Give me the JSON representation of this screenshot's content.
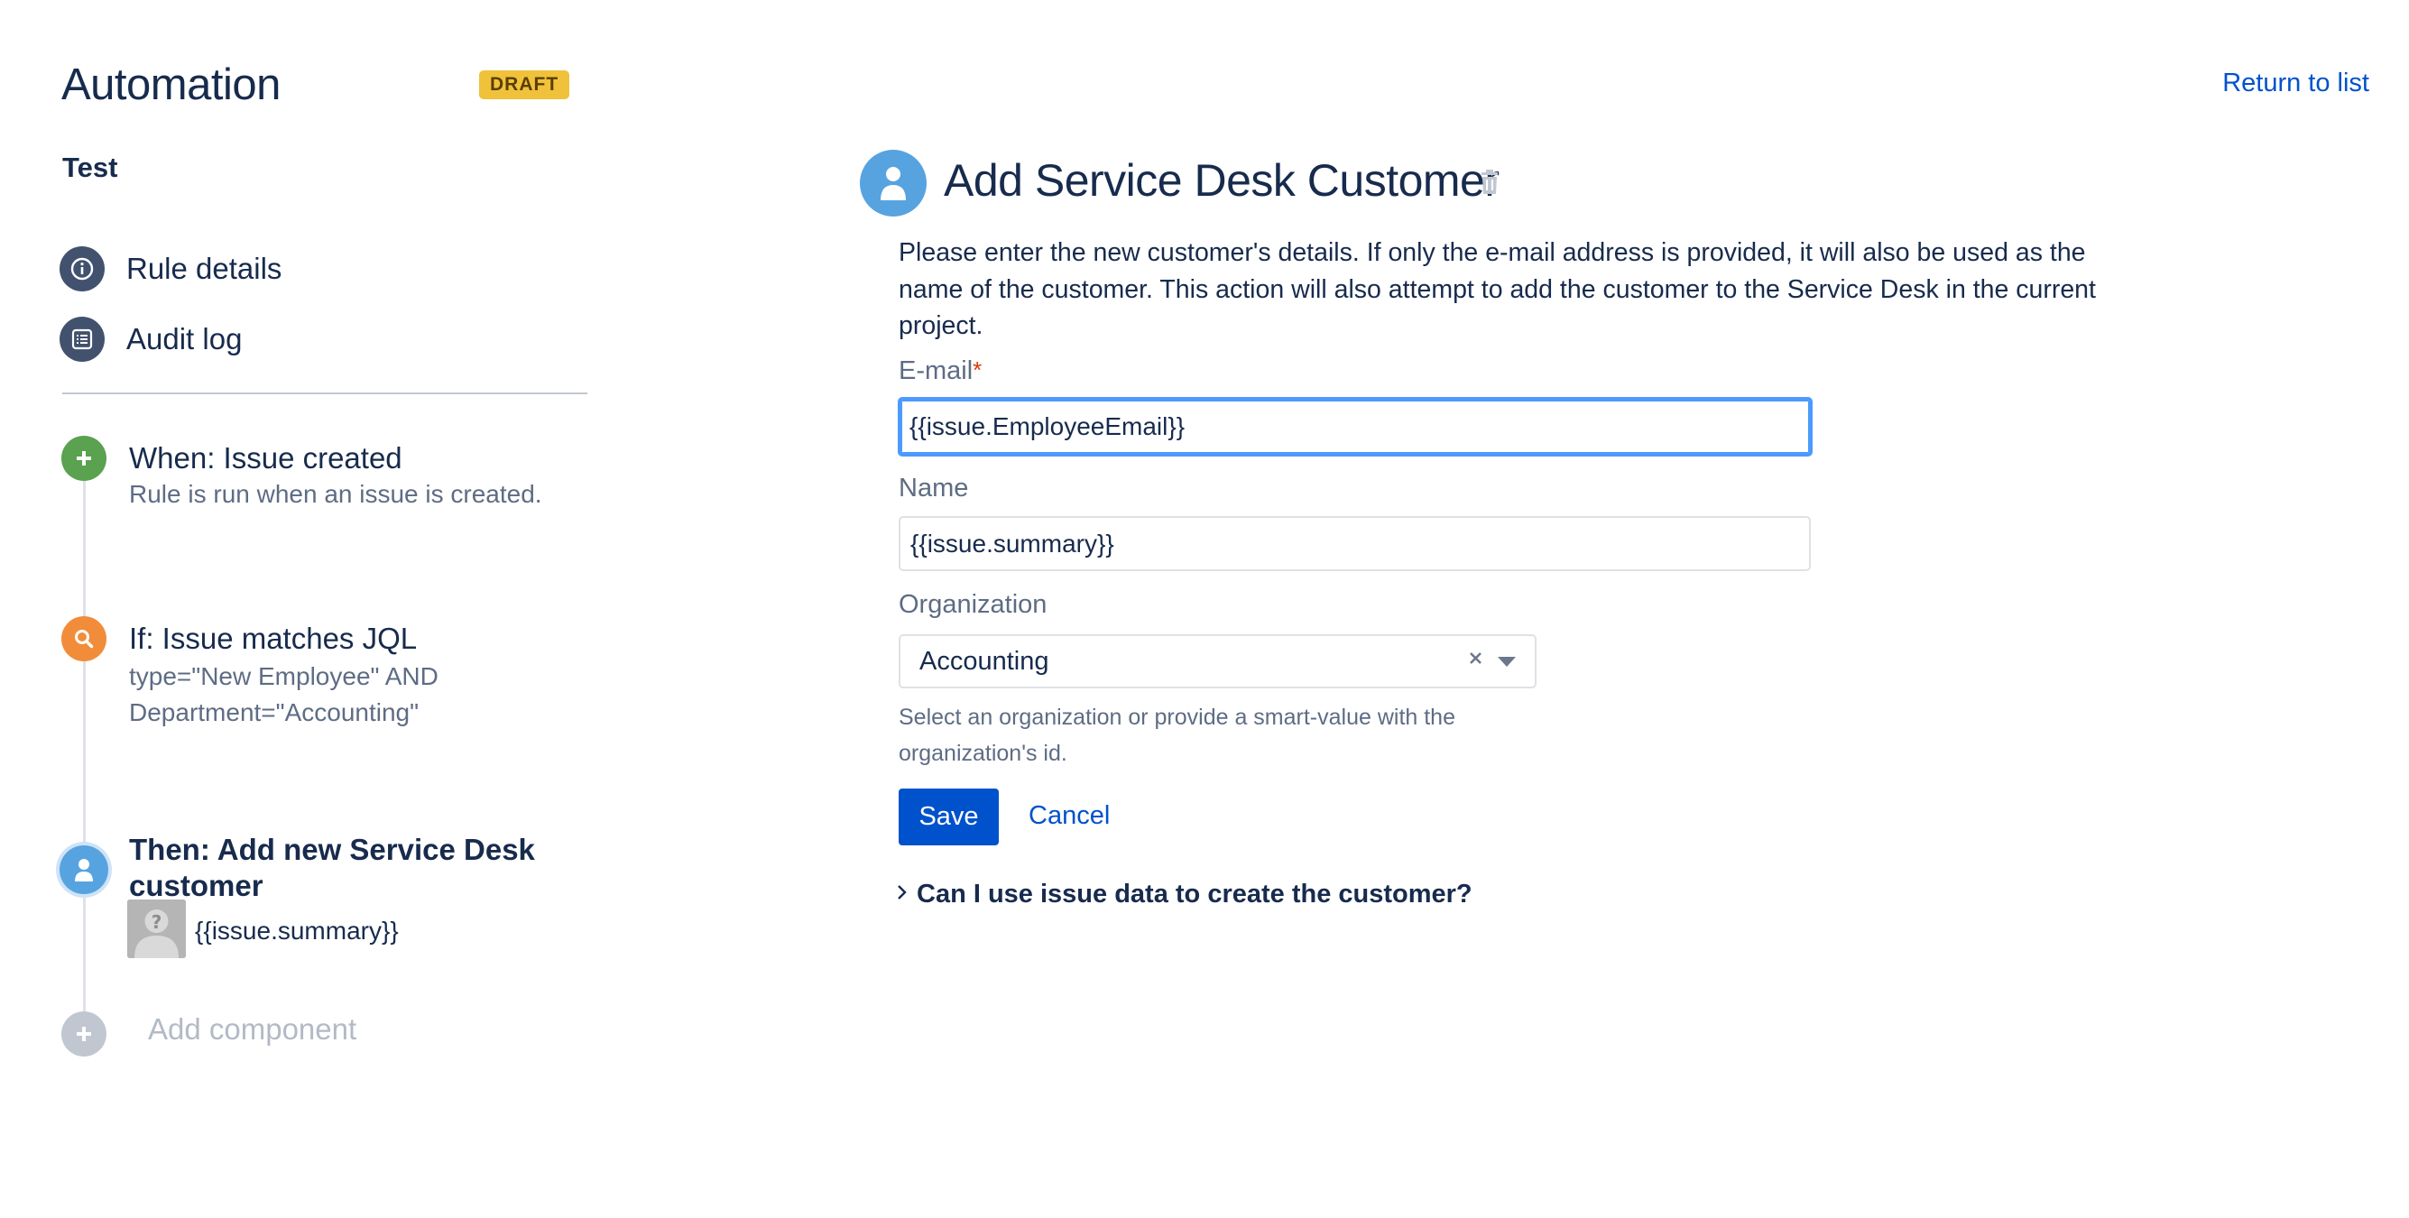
{
  "header": {
    "title": "Automation",
    "badge": "DRAFT",
    "return_link": "Return to list"
  },
  "sidebar": {
    "rule_name": "Test",
    "nav": [
      {
        "label": "Rule details",
        "icon": "info-icon"
      },
      {
        "label": "Audit log",
        "icon": "list-icon"
      }
    ],
    "steps": [
      {
        "title": "When: Issue created",
        "desc": "Rule is run when an issue is created.",
        "icon": "plus-icon",
        "color": "#5aa150"
      },
      {
        "title": "If: Issue matches JQL",
        "desc_line1": "type=\"New Employee\" AND",
        "desc_line2": "Department=\"Accounting\"",
        "icon": "search-icon",
        "color": "#f18d3a"
      },
      {
        "title": "Then: Add new Service Desk customer",
        "value": "{{issue.summary}}",
        "icon": "person-icon",
        "color": "#57a3e0"
      }
    ],
    "add_component": "Add component"
  },
  "panel": {
    "title": "Add Service Desk Customer",
    "description": "Please enter the new customer's details. If only the e-mail address is provided, it will also be used as the name of the customer. This action will also attempt to add the customer to the Service Desk in the current project.",
    "email": {
      "label": "E-mail",
      "required_mark": "*",
      "value": "{{issue.EmployeeEmail}}"
    },
    "name": {
      "label": "Name",
      "value": "{{issue.summary}}"
    },
    "organization": {
      "label": "Organization",
      "selected": "Accounting",
      "help": "Select an organization or provide a smart-value with the organization's id."
    },
    "save_label": "Save",
    "cancel_label": "Cancel",
    "faq": "Can I use issue data to create the customer?"
  },
  "colors": {
    "accent": "#0052cc",
    "draft_badge": "#f0c23c",
    "trigger_green": "#5aa150",
    "condition_orange": "#f18d3a",
    "action_blue": "#57a3e0",
    "focus_ring": "#4c9aff"
  }
}
